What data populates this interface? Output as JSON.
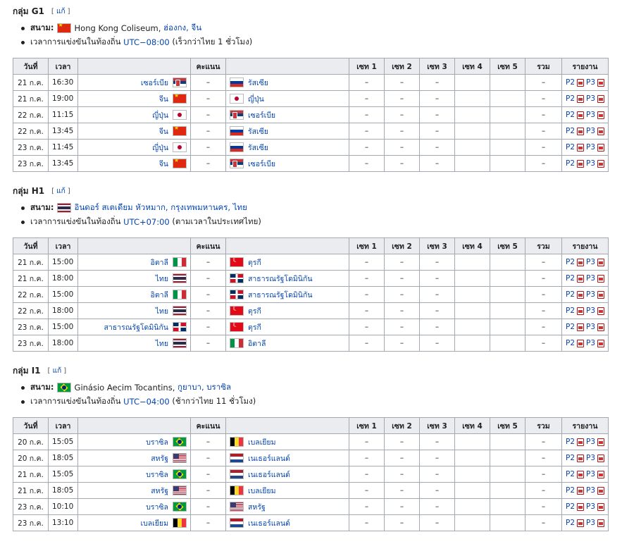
{
  "labels": {
    "venue": "สนาม:",
    "edit": "แก้",
    "headers": [
      "วันที่",
      "เวลา",
      "คะแนน",
      "เซท 1",
      "เซท 2",
      "เซท 3",
      "เซท 4",
      "เซท 5",
      "รวม",
      "รายงาน"
    ],
    "report_p2": "P2",
    "report_p3": "P3",
    "dash": "–"
  },
  "groups": [
    {
      "title": "กลุ่ม G1",
      "venue_flag": "cn",
      "venue_text": "Hong Kong Coliseum, ",
      "venue_link": "ฮ่องกง, จีน",
      "time_prefix": "เวลาการแข่งขันในท้องถิ่น ",
      "time_link": "UTC−08:00",
      "time_suffix": " (เร็วกว่าไทย 1 ชั่วโมง)",
      "matches": [
        {
          "date": "21 ก.ค.",
          "time": "16:30",
          "home": "เซอร์เบีย",
          "home_flag": "rs",
          "away": "รัสเซีย",
          "away_flag": "ru"
        },
        {
          "date": "21 ก.ค.",
          "time": "19:00",
          "home": "จีน",
          "home_flag": "cn",
          "away": "ญี่ปุ่น",
          "away_flag": "jp"
        },
        {
          "date": "22 ก.ค.",
          "time": "11:15",
          "home": "ญี่ปุ่น",
          "home_flag": "jp",
          "away": "เซอร์เบีย",
          "away_flag": "rs"
        },
        {
          "date": "22 ก.ค.",
          "time": "13:45",
          "home": "จีน",
          "home_flag": "cn",
          "away": "รัสเซีย",
          "away_flag": "ru"
        },
        {
          "date": "23 ก.ค.",
          "time": "11:45",
          "home": "ญี่ปุ่น",
          "home_flag": "jp",
          "away": "รัสเซีย",
          "away_flag": "ru"
        },
        {
          "date": "23 ก.ค.",
          "time": "13:45",
          "home": "จีน",
          "home_flag": "cn",
          "away": "เซอร์เบีย",
          "away_flag": "rs"
        }
      ]
    },
    {
      "title": "กลุ่ม H1",
      "venue_flag": "th",
      "venue_text": "",
      "venue_link": "อินดอร์ สเตเดียม หัวหมาก, กรุงเทพมหานคร, ไทย",
      "time_prefix": "เวลาการแข่งขันในท้องถิ่น ",
      "time_link": "UTC+07:00",
      "time_suffix": " (ตามเวลาในประเทศไทย)",
      "matches": [
        {
          "date": "21 ก.ค.",
          "time": "15:00",
          "home": "อิตาลี",
          "home_flag": "it",
          "away": "ตุรกี",
          "away_flag": "tr"
        },
        {
          "date": "21 ก.ค.",
          "time": "18:00",
          "home": "ไทย",
          "home_flag": "th",
          "away": "สาธารณรัฐโดมินิกัน",
          "away_flag": "do"
        },
        {
          "date": "22 ก.ค.",
          "time": "15:00",
          "home": "อิตาลี",
          "home_flag": "it",
          "away": "สาธารณรัฐโดมินิกัน",
          "away_flag": "do"
        },
        {
          "date": "22 ก.ค.",
          "time": "18:00",
          "home": "ไทย",
          "home_flag": "th",
          "away": "ตุรกี",
          "away_flag": "tr"
        },
        {
          "date": "23 ก.ค.",
          "time": "15:00",
          "home": "สาธารณรัฐโดมินิกัน",
          "home_flag": "do",
          "away": "ตุรกี",
          "away_flag": "tr"
        },
        {
          "date": "23 ก.ค.",
          "time": "18:00",
          "home": "ไทย",
          "home_flag": "th",
          "away": "อิตาลี",
          "away_flag": "it"
        }
      ]
    },
    {
      "title": "กลุ่ม I1",
      "venue_flag": "br",
      "venue_text": "Ginásio Aecim Tocantins, ",
      "venue_link": "กูยาบา, บราซิล",
      "time_prefix": "เวลาการแข่งขันในท้องถิ่น ",
      "time_link": "UTC−04:00",
      "time_suffix": " (ช้ากว่าไทย 11 ชั่วโมง)",
      "matches": [
        {
          "date": "20 ก.ค.",
          "time": "15:05",
          "home": "บราซิล",
          "home_flag": "br",
          "away": "เบลเยียม",
          "away_flag": "be"
        },
        {
          "date": "20 ก.ค.",
          "time": "18:05",
          "home": "สหรัฐ",
          "home_flag": "us",
          "away": "เนเธอร์แลนด์",
          "away_flag": "nl"
        },
        {
          "date": "21 ก.ค.",
          "time": "15:05",
          "home": "บราซิล",
          "home_flag": "br",
          "away": "เนเธอร์แลนด์",
          "away_flag": "nl"
        },
        {
          "date": "21 ก.ค.",
          "time": "18:05",
          "home": "สหรัฐ",
          "home_flag": "us",
          "away": "เบลเยียม",
          "away_flag": "be"
        },
        {
          "date": "23 ก.ค.",
          "time": "10:10",
          "home": "บราซิล",
          "home_flag": "br",
          "away": "สหรัฐ",
          "away_flag": "us"
        },
        {
          "date": "23 ก.ค.",
          "time": "13:10",
          "home": "เบลเยียม",
          "home_flag": "be",
          "away": "เนเธอร์แลนด์",
          "away_flag": "nl"
        }
      ]
    }
  ]
}
